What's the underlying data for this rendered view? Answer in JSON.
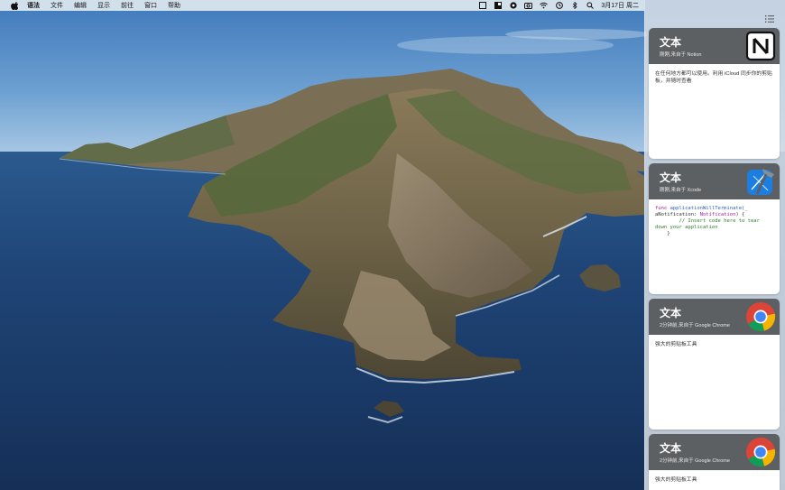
{
  "menubar": {
    "apple_icon": "apple-icon",
    "items": [
      "语法",
      "文件",
      "编辑",
      "显示",
      "前往",
      "窗口",
      "帮助"
    ],
    "status_icons": [
      "square-icon",
      "contrast-square-icon",
      "dark-circle-icon",
      "camera-icon",
      "wifi-icon",
      "time-machine-icon",
      "bluetooth-icon",
      "search-icon"
    ],
    "clock": "3月17日 周二"
  },
  "panel": {
    "list_icon": "list-icon",
    "cards": [
      {
        "title": "文本",
        "subtitle": "刚刚,来自于 Notion",
        "app_icon": "notion-icon",
        "body": "在任何地方都可以使用。利用 iCloud 同步你的剪贴板，并随时查看"
      },
      {
        "title": "文本",
        "subtitle": "刚刚,来自于 Xcode",
        "app_icon": "xcode-icon",
        "code": {
          "kw": "func",
          "fn": "applicationWillTerminate(_",
          "line2_a": "aNotification: ",
          "line2_type": "Notification",
          "line2_b": ") {",
          "comment": "// Insert code here to tear",
          "comment2": "down your application",
          "close": "}"
        }
      },
      {
        "title": "文本",
        "subtitle": "2分钟前,来自于 Google Chrome",
        "app_icon": "chrome-icon",
        "body": "强大的剪贴板工具"
      },
      {
        "title": "文本",
        "subtitle": "2分钟前,来自于 Google Chrome",
        "app_icon": "chrome-icon",
        "body": "强大的剪贴板工具"
      }
    ]
  },
  "colors": {
    "card_header": "#5d6063",
    "panel": "#d6dee6",
    "ocean": "#1b3a66",
    "sky": "#4f89c4"
  }
}
